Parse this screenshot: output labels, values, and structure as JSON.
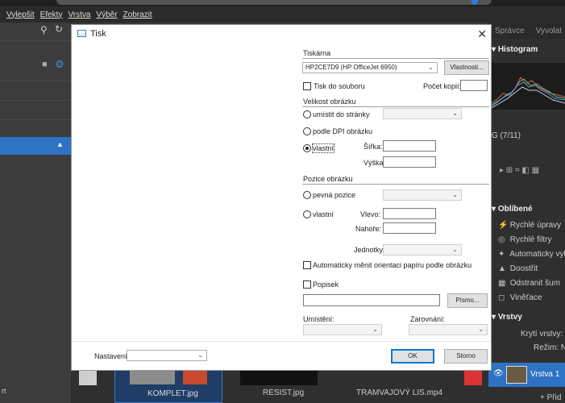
{
  "app": {
    "menu": [
      "Vylepšit",
      "Efekty",
      "Vrstva",
      "Výběr",
      "Zobrazit"
    ],
    "right_tabs": [
      "Správce",
      "Vyvolat"
    ],
    "histogram_label": "Histogram",
    "image_counter": "G (7/11)",
    "favorites_label": "Oblíbené",
    "favorites": [
      "Rychlé úpravy",
      "Rychlé filtry",
      "Automaticky vylepšit",
      "Doostřit",
      "Odstranit šum",
      "Viněťace"
    ],
    "layers_label": "Vrstvy",
    "opacity_label": "Krytí vrstvy:",
    "mode_label": "Režim:",
    "mode_value": "N",
    "layer_name": "Vrstva 1",
    "add_label": "Přid",
    "bottom_left_label": "rt",
    "thumbnails": [
      "KOMPLET.jpg",
      "RESIST.jpg",
      "TRAMVAJOVÝ LIS.mp4"
    ]
  },
  "dialog": {
    "title": "Tisk",
    "printer_section": "Tiskárna",
    "printer_value": "HP2CE7D9 (HP OfficeJet 6950)",
    "properties_button": "Vlastnosti...",
    "print_to_file": "Tisk do souboru",
    "copies_label": "Počet kopií:",
    "copies_value": "",
    "size_section": "Velikost obrázku",
    "fit_page": "umístit do stránky",
    "by_dpi": "podle DPI obrázku",
    "custom": "vlastní",
    "width_label": "Šířka:",
    "height_label": "Výška:",
    "position_section": "Pozice obrázku",
    "fixed_position": "pevná pozice",
    "custom_position": "vlastní",
    "left_label": "Vlevo:",
    "top_label": "Nahoře:",
    "units_label": "Jednotky:",
    "auto_orient": "Automaticky měnit orientaci papíru podle obrázku",
    "caption": "Popisek",
    "font_button": "Písmo...",
    "placement_label": "Umístění:",
    "alignment_label": "Zarovnání:",
    "settings_label": "Nastavení:",
    "ok_button": "OK",
    "cancel_button": "Storno"
  }
}
